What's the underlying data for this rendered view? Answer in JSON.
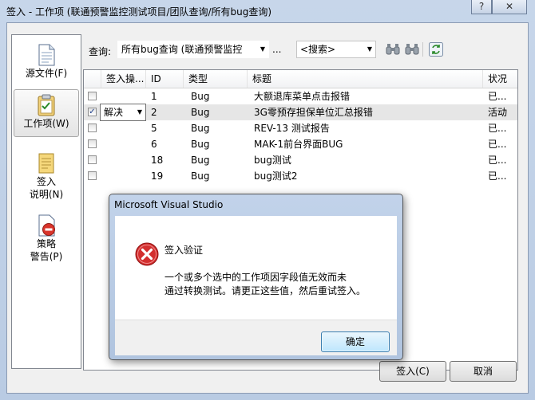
{
  "window": {
    "title": "签入 - 工作项 (联通预警监控测试项目/团队查询/所有bug查询)",
    "help_label": "?",
    "close_label": "✕"
  },
  "nav": {
    "items": [
      {
        "label": "源文件(F)",
        "icon": "source-files-icon",
        "active": false
      },
      {
        "label": "工作项(W)",
        "icon": "work-items-icon",
        "active": true
      },
      {
        "label_line1": "签入",
        "label_line2": "说明(N)",
        "icon": "checkin-notes-icon",
        "active": false
      },
      {
        "label_line1": "策略",
        "label_line2": "警告(P)",
        "icon": "policy-warnings-icon",
        "active": false
      }
    ]
  },
  "toolbar": {
    "query_label": "查询:",
    "query_value": "所有bug查询 (联通预警监控",
    "more_label": "...",
    "search_value": "<搜索>",
    "find_icon": "binoculars-icon",
    "find_next_icon": "binoculars-next-icon",
    "refresh_icon": "refresh-icon"
  },
  "grid": {
    "columns": [
      "签入操...",
      "ID",
      "类型",
      "标题",
      "状况"
    ],
    "rows": [
      {
        "checked": false,
        "action": "",
        "id": "1",
        "type": "Bug",
        "title": "大额退库菜单点击报错",
        "status": "已..."
      },
      {
        "checked": true,
        "action": "解决",
        "id": "2",
        "type": "Bug",
        "title": "3G零预存担保单位汇总报错",
        "status": "活动"
      },
      {
        "checked": false,
        "action": "",
        "id": "5",
        "type": "Bug",
        "title": "REV-13 测试报告",
        "status": "已..."
      },
      {
        "checked": false,
        "action": "",
        "id": "6",
        "type": "Bug",
        "title": "MAK-1前台界面BUG",
        "status": "已..."
      },
      {
        "checked": false,
        "action": "",
        "id": "18",
        "type": "Bug",
        "title": "bug测试",
        "status": "已..."
      },
      {
        "checked": false,
        "action": "",
        "id": "19",
        "type": "Bug",
        "title": "bug测试2",
        "status": "已..."
      }
    ]
  },
  "buttons": {
    "checkin": "签入(C)",
    "cancel": "取消"
  },
  "dialog": {
    "title": "Microsoft Visual Studio",
    "heading": "签入验证",
    "message_line1": "一个或多个选中的工作项因字段值无效而未",
    "message_line2": "通过转换测试。请更正这些值，然后重试签入。",
    "ok_label": "确定",
    "icon": "error-icon"
  }
}
